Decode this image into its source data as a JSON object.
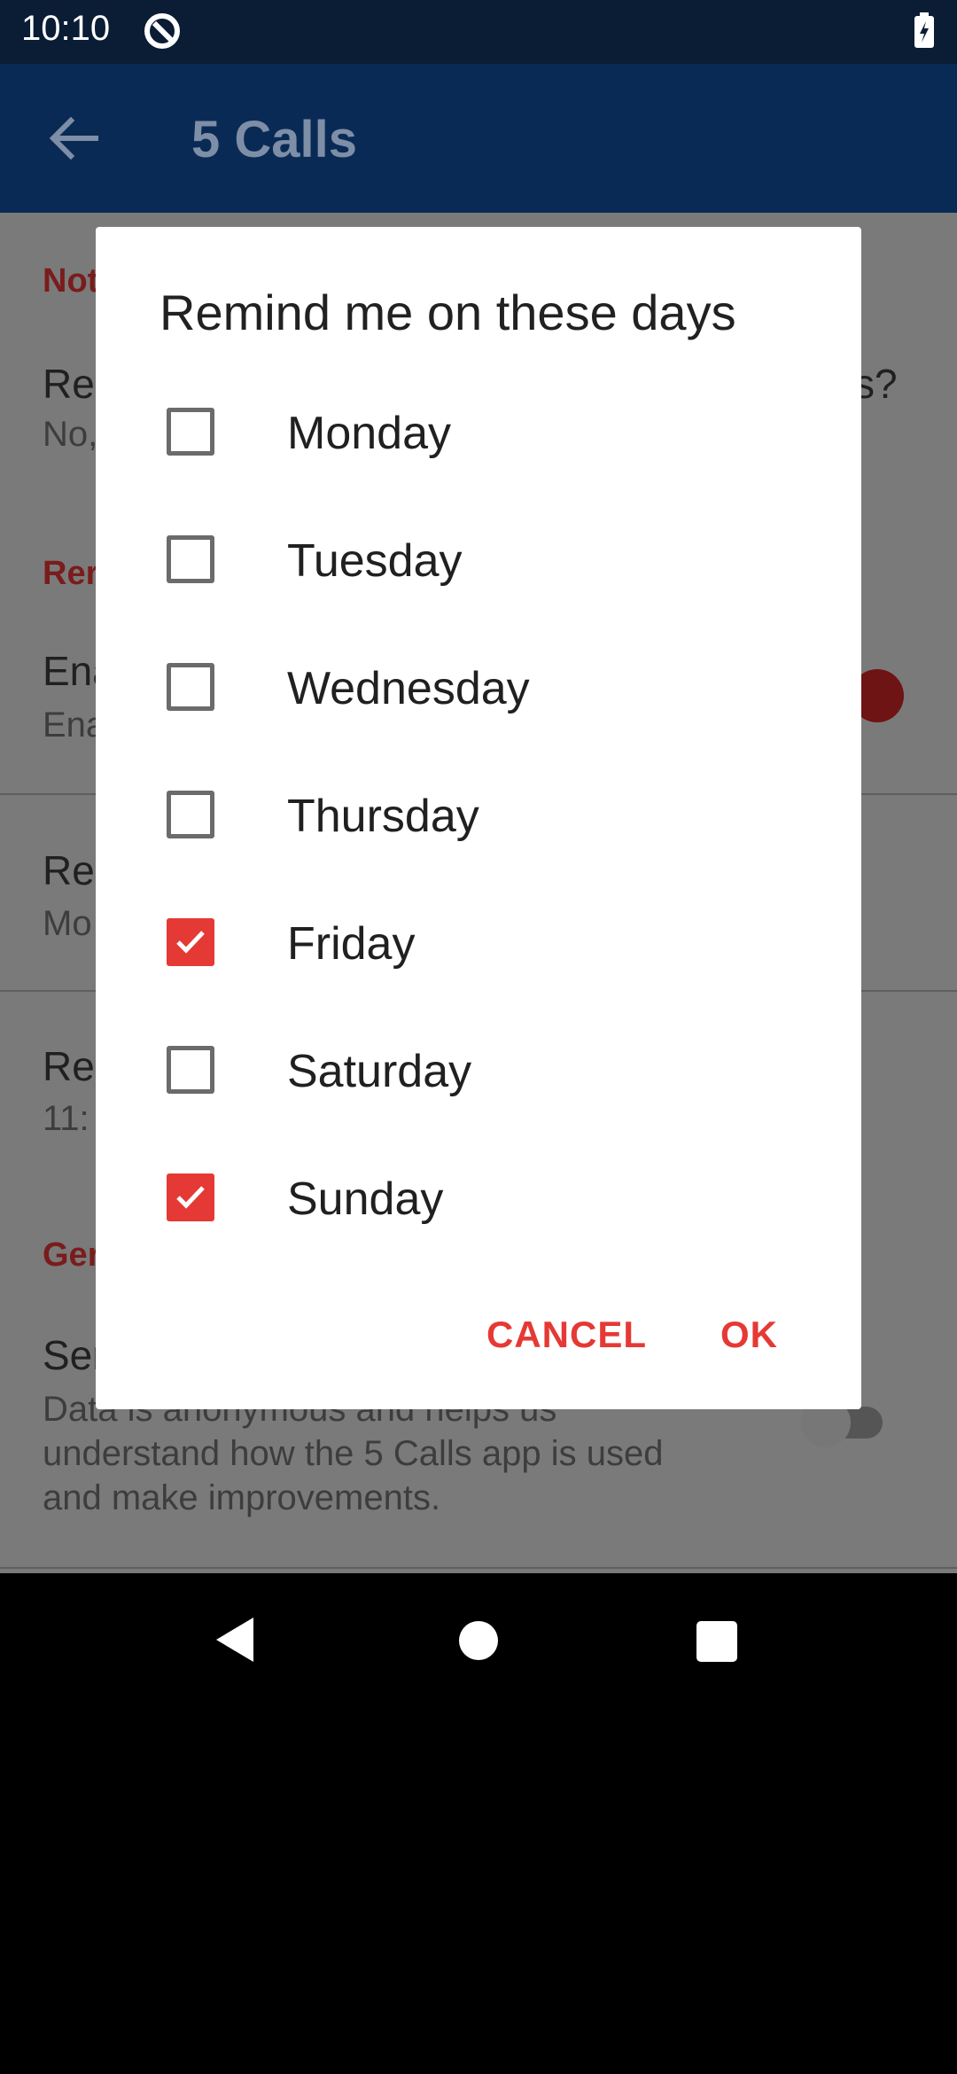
{
  "status_bar": {
    "time": "10:10"
  },
  "app_bar": {
    "title": "5 Calls"
  },
  "background": {
    "sections": [
      {
        "header": "Not"
      },
      {
        "title": "Rec",
        "summary": "No,",
        "title_tail": "s?"
      },
      {
        "header": "Rer"
      },
      {
        "title": "Ena",
        "summary": "Ena"
      },
      {
        "title": "Rer",
        "summary": "Mo"
      },
      {
        "title": "Rer",
        "summary": "11:"
      },
      {
        "header": "Ger"
      },
      {
        "title": "Ser",
        "summary_lines": [
          "Data is anonymous and helps us",
          "understand how the 5 Calls app is used",
          "and make improvements."
        ]
      }
    ]
  },
  "dialog": {
    "title": "Remind me on these days",
    "options": [
      {
        "label": "Monday",
        "checked": false
      },
      {
        "label": "Tuesday",
        "checked": false
      },
      {
        "label": "Wednesday",
        "checked": false
      },
      {
        "label": "Thursday",
        "checked": false
      },
      {
        "label": "Friday",
        "checked": true
      },
      {
        "label": "Saturday",
        "checked": false
      },
      {
        "label": "Sunday",
        "checked": true
      }
    ],
    "cancel_label": "CANCEL",
    "ok_label": "OK"
  },
  "colors": {
    "accent": "#e53935",
    "app_bar": "#0a2a56",
    "status_bar": "#0a1d35"
  }
}
